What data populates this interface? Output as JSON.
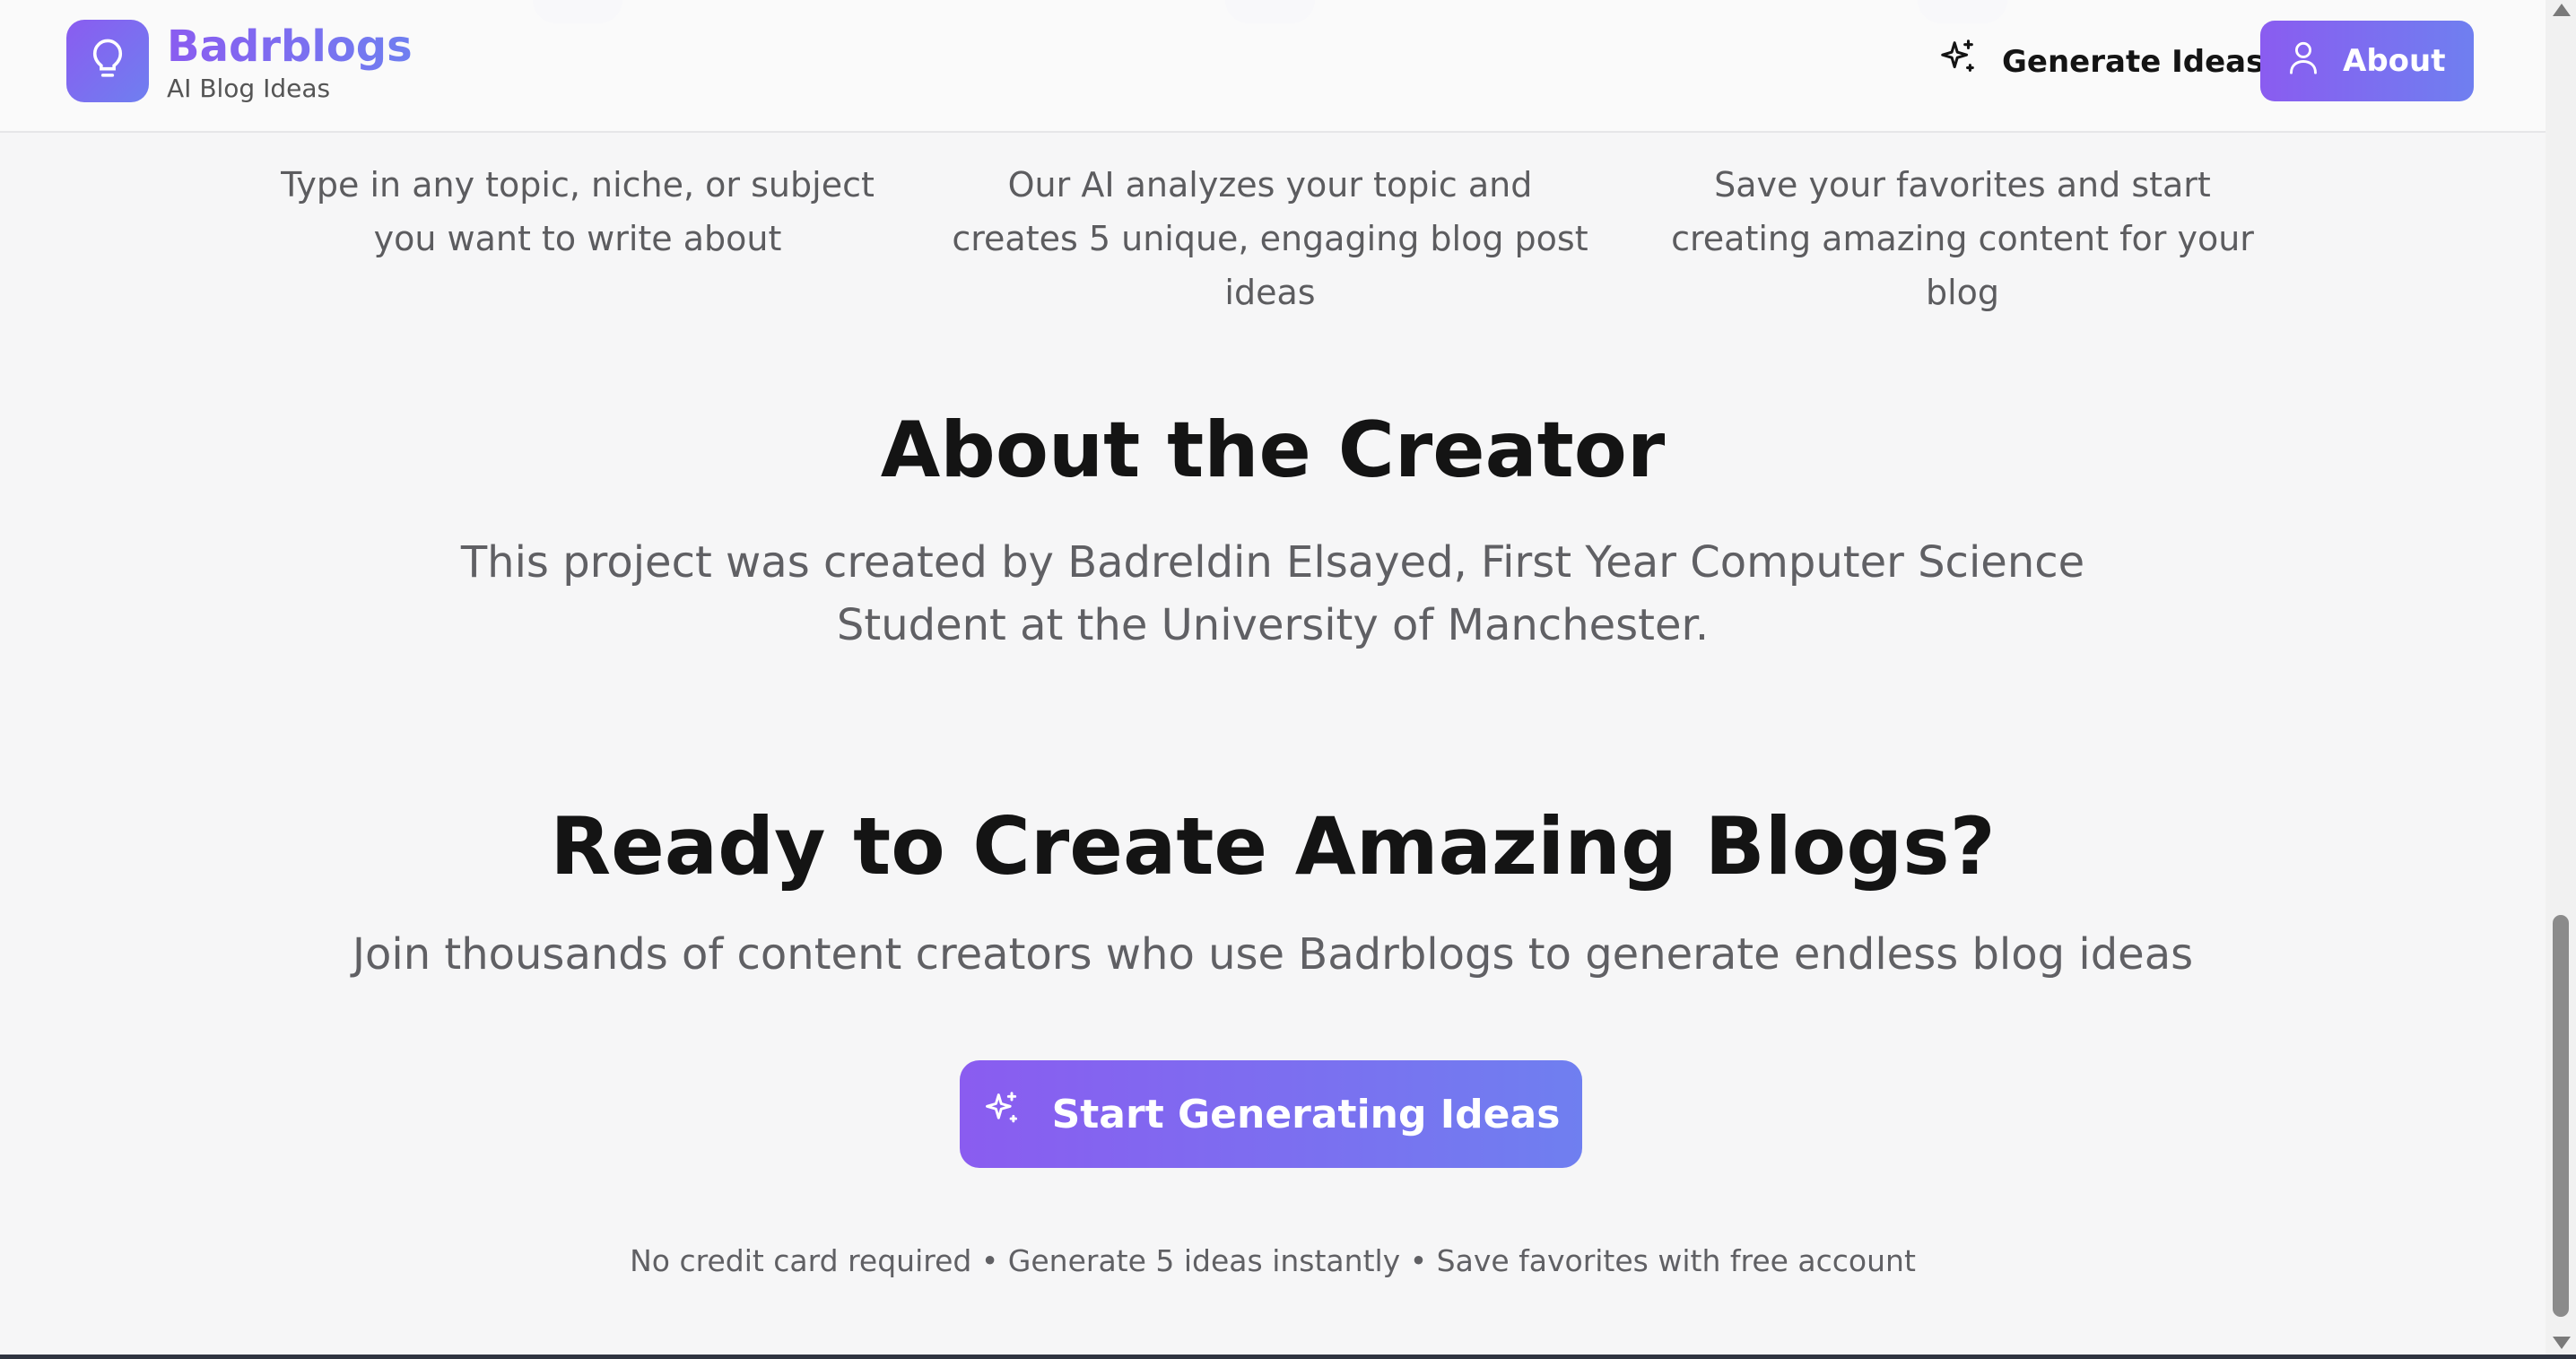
{
  "colors": {
    "accent_start": "#8a5cf0",
    "accent_end": "#6f7ff0",
    "text": "#141414",
    "muted": "#606064"
  },
  "header": {
    "brand_name": "Badrblogs",
    "brand_tagline": "AI Blog Ideas",
    "logo_icon": "lightbulb-icon",
    "nav": {
      "generate_label": "Generate Ideas",
      "generate_icon": "sparkles-icon",
      "about_label": "About",
      "about_icon": "user-icon"
    }
  },
  "steps": [
    {
      "description": "Type in any topic, niche, or subject you want to write about"
    },
    {
      "description": "Our AI analyzes your topic and creates 5 unique, engaging blog post ideas"
    },
    {
      "description": "Save your favorites and start creating amazing content for your blog"
    }
  ],
  "about": {
    "title": "About the Creator",
    "text": "This project was created by Badreldin Elsayed, First Year Computer Science Student at the University of Manchester."
  },
  "cta": {
    "title": "Ready to Create Amazing Blogs?",
    "subtitle": "Join thousands of content creators who use Badrblogs to generate endless blog ideas",
    "button_label": "Start Generating Ideas",
    "button_icon": "sparkles-icon",
    "note": "No credit card required • Generate 5 ideas instantly • Save favorites with free account"
  }
}
